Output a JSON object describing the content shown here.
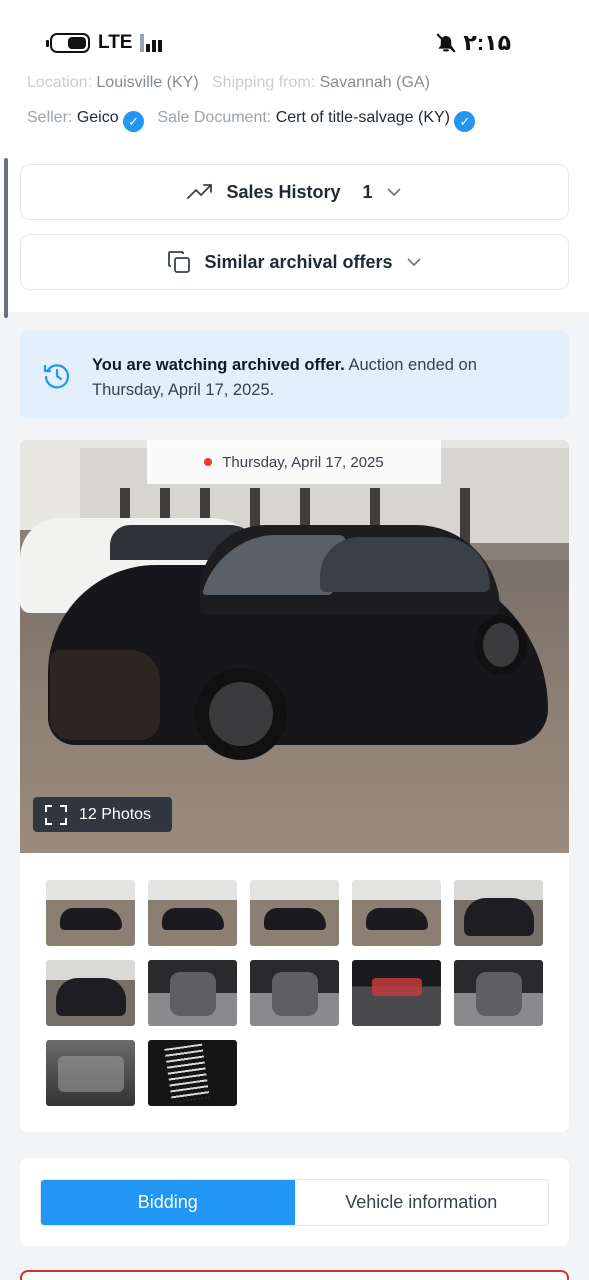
{
  "status_bar": {
    "network": "LTE",
    "time": "۲:۱۵",
    "icons": [
      "battery-icon",
      "signal-icon",
      "bell-off-icon"
    ]
  },
  "lot_info": {
    "location_label": "Location:",
    "location_value": "Louisville (KY)",
    "shipping_label": "Shipping from:",
    "shipping_value": "Savannah (GA)",
    "seller_label": "Seller:",
    "seller_value": "Geico",
    "sale_document_label": "Sale Document:",
    "sale_document_value": "Cert of title-salvage (KY)"
  },
  "sales_history": {
    "label": "Sales History",
    "count": "1"
  },
  "similar_offers": {
    "label": "Similar archival offers"
  },
  "notice": {
    "bold": "You are watching archived offer.",
    "text": " Auction ended on Thursday, April 17, 2025."
  },
  "gallery": {
    "date": "Thursday, April 17, 2025",
    "photos_label": "12 Photos",
    "thumbnails": [
      "exterior-left",
      "exterior-left",
      "exterior-left",
      "exterior-rear",
      "front-damage",
      "rear",
      "interior-front-seats",
      "dashboard",
      "instrument-cluster",
      "interior-rear-seats",
      "engine-bay",
      "vin-label"
    ]
  },
  "tabs": {
    "bidding": "Bidding",
    "vehicle_information": "Vehicle information",
    "active": "bidding"
  },
  "colors": {
    "accent": "#2196f3",
    "notice_bg": "#e3f0fb",
    "alert_border": "#d32f2f"
  }
}
